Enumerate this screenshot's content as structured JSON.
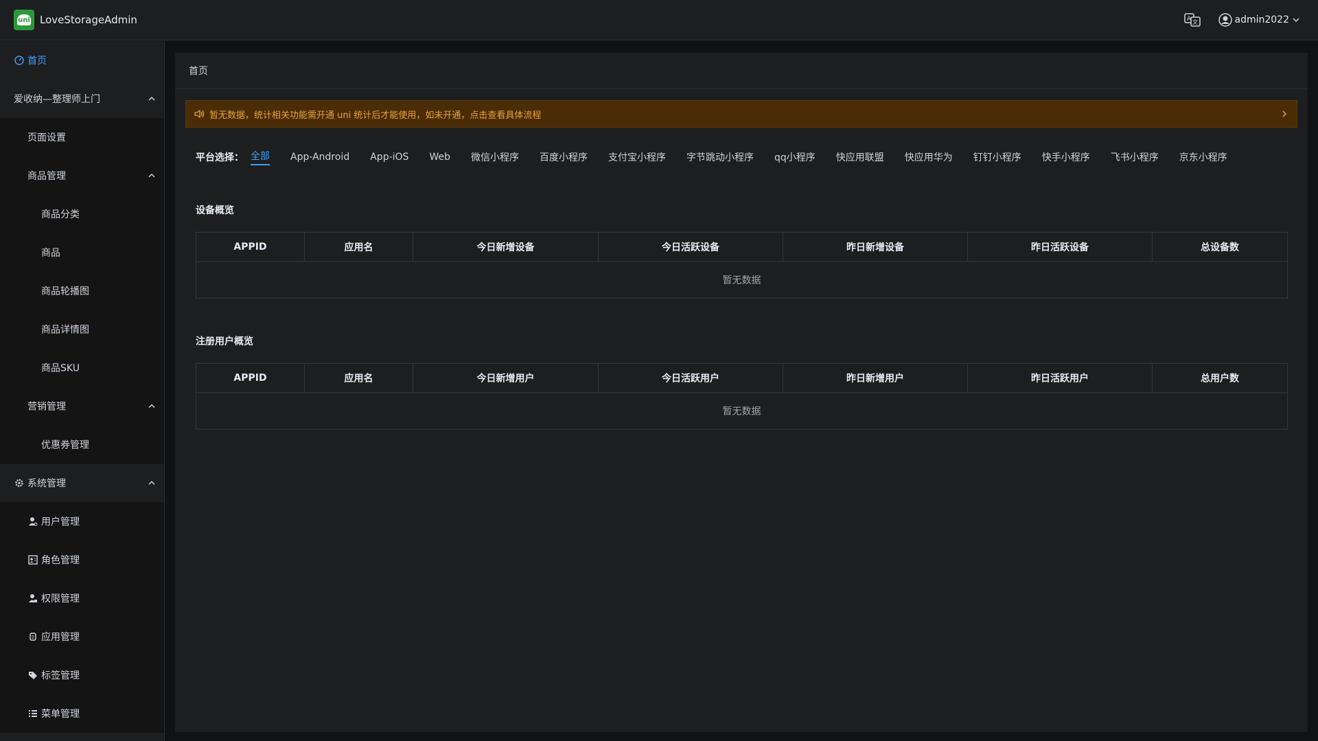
{
  "app": {
    "title": "LoveStorageAdmin",
    "logo_text": "uni"
  },
  "header": {
    "username": "admin2022"
  },
  "sidebar": {
    "items": [
      {
        "label": "首页"
      },
      {
        "label": "爱收纳—整理师上门"
      },
      {
        "label": "页面设置"
      },
      {
        "label": "商品管理"
      },
      {
        "label": "商品分类"
      },
      {
        "label": "商品"
      },
      {
        "label": "商品轮播图"
      },
      {
        "label": "商品详情图"
      },
      {
        "label": "商品SKU"
      },
      {
        "label": "营销管理"
      },
      {
        "label": "优惠券管理"
      },
      {
        "label": "系统管理"
      },
      {
        "label": "用户管理"
      },
      {
        "label": "角色管理"
      },
      {
        "label": "权限管理"
      },
      {
        "label": "应用管理"
      },
      {
        "label": "标签管理"
      },
      {
        "label": "菜单管理"
      }
    ]
  },
  "breadcrumb": "首页",
  "notice": {
    "text": "暂无数据，统计相关功能需开通 uni 统计后才能使用，如未开通，点击查看具体流程"
  },
  "platforms": {
    "label": "平台选择：",
    "options": [
      "全部",
      "App-Android",
      "App-iOS",
      "Web",
      "微信小程序",
      "百度小程序",
      "支付宝小程序",
      "字节跳动小程序",
      "qq小程序",
      "快应用联盟",
      "快应用华为",
      "钉钉小程序",
      "快手小程序",
      "飞书小程序",
      "京东小程序"
    ]
  },
  "devices": {
    "title": "设备概览",
    "columns": [
      "APPID",
      "应用名",
      "今日新增设备",
      "今日活跃设备",
      "昨日新增设备",
      "昨日活跃设备",
      "总设备数"
    ],
    "empty": "暂无数据"
  },
  "users": {
    "title": "注册用户概览",
    "columns": [
      "APPID",
      "应用名",
      "今日新增用户",
      "今日活跃用户",
      "昨日新增用户",
      "昨日活跃用户",
      "总用户数"
    ],
    "empty": "暂无数据"
  },
  "colors": {
    "accent": "#409eff",
    "warning": "#e6a23c",
    "brand": "#2b9939"
  }
}
